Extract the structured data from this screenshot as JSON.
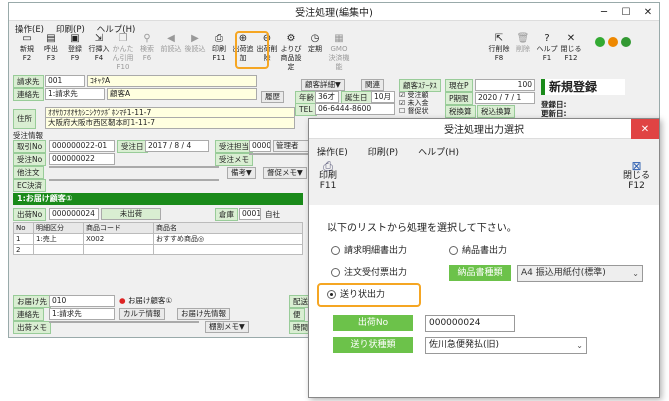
{
  "main": {
    "title": "受注処理(編集中)",
    "menu": [
      "操作(E)",
      "印刷(P)",
      "ヘルプ(H)"
    ],
    "toolbar": [
      {
        "l1": "新規",
        "l2": "F2",
        "icon": "new-icon",
        "g": "▭"
      },
      {
        "l1": "呼出",
        "l2": "F3",
        "icon": "open-icon",
        "g": "▤"
      },
      {
        "l1": "登録",
        "l2": "F9",
        "icon": "save-icon",
        "g": "▣"
      },
      {
        "l1": "行挿入",
        "l2": "F4",
        "icon": "insert-row-icon",
        "g": "⇲"
      },
      {
        "l1": "かんたん引用",
        "l2": "F10",
        "icon": "quote-icon",
        "g": "❐",
        "dis": true
      },
      {
        "l1": "検索",
        "l2": "F6",
        "icon": "search-icon",
        "g": "⚲",
        "dis": true
      },
      {
        "l1": "前読込",
        "l2": "",
        "icon": "prev-icon",
        "g": "◀",
        "dis": true
      },
      {
        "l1": "後読込",
        "l2": "",
        "icon": "next-icon",
        "g": "▶",
        "dis": true
      },
      {
        "l1": "印刷",
        "l2": "F11",
        "icon": "print-icon",
        "g": "⎙"
      },
      {
        "l1": "出荷追加",
        "l2": "",
        "icon": "add-ship-icon",
        "g": "⊕"
      },
      {
        "l1": "出荷削除",
        "l2": "",
        "icon": "delete-ship-icon",
        "g": "⊖"
      },
      {
        "l1": "よりぴ",
        "l2": "商品設定",
        "icon": "product-setting-icon",
        "g": "⚙"
      },
      {
        "l1": "定期",
        "l2": "",
        "icon": "regular-icon",
        "g": "◷"
      },
      {
        "l1": "GMO",
        "l2": "決済機能",
        "icon": "payment-icon",
        "g": "▦",
        "dis": true
      }
    ],
    "toolbar_right": [
      {
        "l1": "行削除",
        "l2": "F8",
        "icon": "delete-row-icon",
        "g": "⇱"
      },
      {
        "l1": "削除",
        "l2": "",
        "icon": "trash-icon",
        "g": "🗑",
        "dis": true
      },
      {
        "l1": "ヘルプ",
        "l2": "F1",
        "icon": "help-icon",
        "g": "?"
      },
      {
        "l1": "閉じる",
        "l2": "F12",
        "icon": "close-icon",
        "g": "✕"
      }
    ],
    "customer": {
      "seikyu_label": "請求先",
      "seikyu_code": "001",
      "kana": "ｺｷｬｸA",
      "renraku_label": "連絡先",
      "renraku_value": "1:請求先",
      "name": "顧客A",
      "address_label": "住所",
      "address_kana": "ｵｵｻｶﾌｵｵｻｶｼﾆｼｸｳﾂﾎﾞﾎﾝﾏﾁ1-11-7",
      "address": "大阪府大阪市西区靭本町1-11-7",
      "kokyaku_btn": "顧客詳細▼",
      "kanren_btn": "関連",
      "rireki_btn": "履歴"
    },
    "info": {
      "nendai": "年齢",
      "age": "36才",
      "birth_label": "誕生日",
      "birth": "10月",
      "tel_label": "TEL",
      "tel": "06-6444-8600",
      "status_label": "顧客ｽﾃｰﾀｽ",
      "status_chk": [
        "受注顧",
        "未入金",
        "督促状"
      ],
      "genzai_label": "現在P",
      "genzai_val": "100",
      "pkikan_label": "P期限",
      "pkikan_val": "2020 / 7 / 1",
      "zeiryaku_label": "税換算",
      "zeiryaku2": "税込換算"
    },
    "new_reg": "新規登録",
    "reg_date": "登録日:",
    "upd_date": "更新日:",
    "order": {
      "section": "受注情報",
      "torihiki_label": "取引No",
      "torihiki_val": "000000022-01",
      "juchu_date_label": "受注日",
      "juchu_date": "2017 / 8 / 4",
      "tanto_label": "受注担当",
      "tanto_code": "0000",
      "tanto_name": "管理者",
      "juchu_no_label": "受注No",
      "juchu_no": "000000022",
      "memo_label": "受注メモ",
      "tabun_label": "他注文",
      "biko_btn": "備考▼",
      "tokusoku_btn": "督促メモ▼",
      "ec_label": "EC決済"
    },
    "delivery": {
      "bar": "1:お届け顧客①",
      "shukka_label": "出荷No",
      "shukka_no": "000000024",
      "mishukka": "未出荷",
      "souko_label": "倉庫",
      "souko_code": "0001",
      "souko_name": "自社",
      "cols": [
        "No",
        "明細区分",
        "商品コード",
        "商品名"
      ],
      "rows": [
        {
          "no": "1",
          "kubun": "1:売上",
          "code": "X002",
          "name": "おすすめ商品◎"
        },
        {
          "no": "2",
          "kubun": "",
          "code": "",
          "name": ""
        }
      ],
      "otodoke_label": "お届け先",
      "otodoke_code": "010",
      "otodoke_name": "お届け顧客①",
      "haisou_label": "配送",
      "renraku_label": "連絡先",
      "renraku_val": "1:請求先",
      "karte_btn": "カルテ情報",
      "otodoke_jouhou_btn": "お届け先情報",
      "bin_label": "便",
      "shukka_memo_label": "出荷メモ",
      "tana_btn": "棚割メモ▼",
      "jikan_label": "時間"
    }
  },
  "dialog": {
    "title": "受注処理出力選択",
    "menu": [
      "操作(E)",
      "印刷(P)",
      "ヘルプ(H)"
    ],
    "print_label": "印刷",
    "print_key": "F11",
    "close_label": "閉じる",
    "close_key": "F12",
    "instruction": "以下のリストから処理を選択して下さい。",
    "options": {
      "seikyu": "請求明細書出力",
      "nouhin": "納品書出力",
      "chumon": "注文受付票出力",
      "okuri": "送り状出力"
    },
    "nouhin_type_label": "納品書種類",
    "nouhin_type_value": "A4 振込用紙付(標準)",
    "shukka_label": "出荷No",
    "shukka_value": "000000024",
    "okuri_type_label": "送り状種類",
    "okuri_type_value": "佐川急便発払(旧)"
  }
}
